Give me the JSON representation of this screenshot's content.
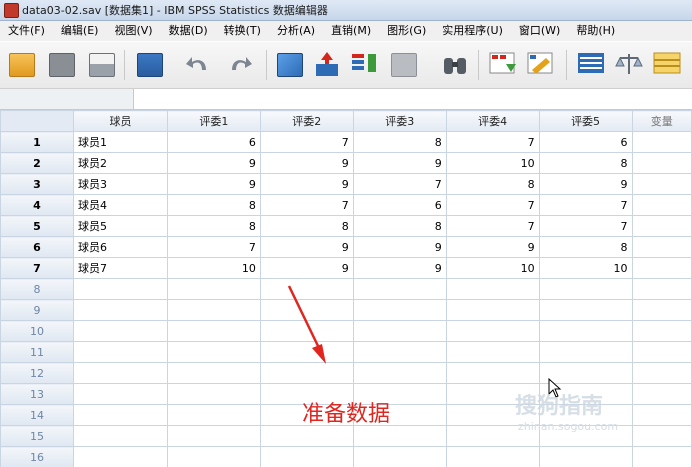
{
  "window": {
    "title": "data03-02.sav [数据集1] - IBM SPSS Statistics 数据编辑器"
  },
  "menu": [
    "文件(F)",
    "编辑(E)",
    "视图(V)",
    "数据(D)",
    "转换(T)",
    "分析(A)",
    "直销(M)",
    "图形(G)",
    "实用程序(U)",
    "窗口(W)",
    "帮助(H)"
  ],
  "toolbar": {
    "icons": [
      "open-folder-icon",
      "save-icon",
      "print-icon",
      "dialog-recall-icon",
      "undo-icon",
      "redo-icon",
      "goto-case-icon",
      "goto-variable-icon",
      "variables-icon",
      "run-descriptives-icon",
      "find-icon",
      "insert-cases-icon",
      "insert-variable-icon",
      "split-file-icon",
      "weight-cases-icon",
      "select-cases-icon"
    ]
  },
  "grid": {
    "columns": [
      "球员",
      "评委1",
      "评委2",
      "评委3",
      "评委4",
      "评委5",
      "变量"
    ],
    "rows": [
      {
        "n": "1",
        "cells": [
          "球员1",
          "6",
          "7",
          "8",
          "7",
          "6"
        ]
      },
      {
        "n": "2",
        "cells": [
          "球员2",
          "9",
          "9",
          "9",
          "10",
          "8"
        ]
      },
      {
        "n": "3",
        "cells": [
          "球员3",
          "9",
          "9",
          "7",
          "8",
          "9"
        ]
      },
      {
        "n": "4",
        "cells": [
          "球员4",
          "8",
          "7",
          "6",
          "7",
          "7"
        ]
      },
      {
        "n": "5",
        "cells": [
          "球员5",
          "8",
          "8",
          "8",
          "7",
          "7"
        ]
      },
      {
        "n": "6",
        "cells": [
          "球员6",
          "7",
          "9",
          "9",
          "9",
          "8"
        ]
      },
      {
        "n": "7",
        "cells": [
          "球员7",
          "10",
          "9",
          "9",
          "10",
          "10"
        ]
      }
    ],
    "empty_rows": [
      "8",
      "9",
      "10",
      "11",
      "12",
      "13",
      "14",
      "15",
      "16"
    ]
  },
  "annotation": {
    "text": "准备数据",
    "color": "#e0261f"
  },
  "watermark": {
    "text": "搜狗指南",
    "sub": "zhinan.sogou.com"
  }
}
